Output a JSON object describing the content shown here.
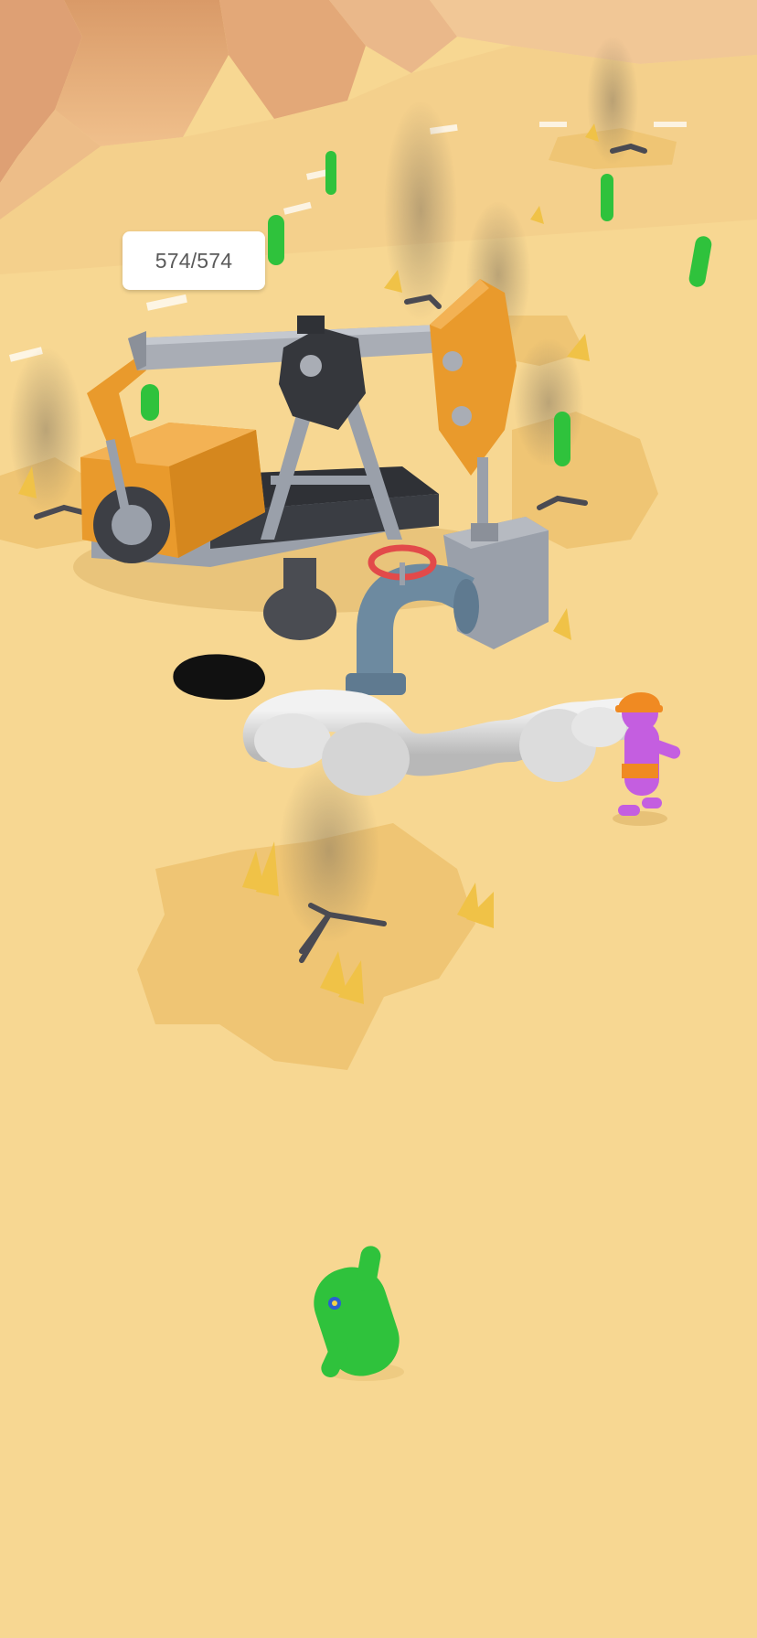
{
  "hud": {
    "oil_counter": "574/574",
    "oil_current": 574,
    "oil_capacity": 574
  },
  "scene": {
    "setting": "desert",
    "colors": {
      "sand": "#f6d68e",
      "sand_shadow": "#efc77a",
      "rock": "#e7b07e",
      "rig_orange": "#e99a2c",
      "rig_gray": "#a9adb5",
      "rig_dark": "#3b3d42",
      "pipe_blue": "#6d8aa0",
      "hose_white": "#d9d9d9",
      "oil_black": "#111111",
      "worker_purple": "#c45ee0",
      "worker_helmet": "#f08a22",
      "cactus_green": "#2fc23c",
      "valve_red": "#e24a4a"
    }
  }
}
